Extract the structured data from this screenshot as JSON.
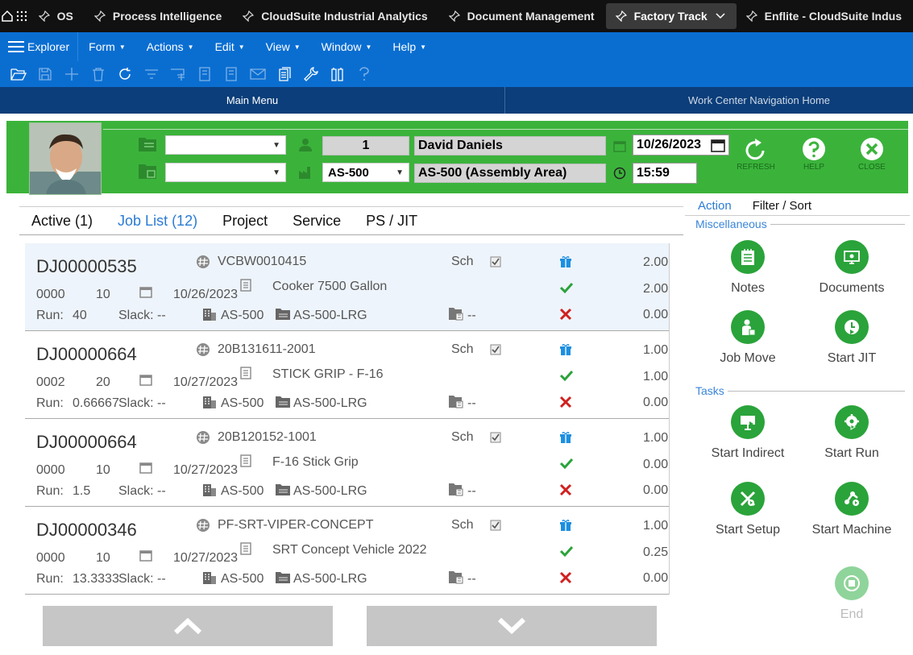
{
  "appbar": {
    "tabs": [
      {
        "label": "OS"
      },
      {
        "label": "Process Intelligence"
      },
      {
        "label": "CloudSuite Industrial Analytics"
      },
      {
        "label": "Document Management"
      },
      {
        "label": "Factory Track",
        "active": true
      },
      {
        "label": "Enflite - CloudSuite Indus"
      }
    ]
  },
  "menubar": {
    "explorer": "Explorer",
    "items": [
      "Form",
      "Actions",
      "Edit",
      "View",
      "Window",
      "Help"
    ]
  },
  "nav": {
    "main_menu": "Main Menu",
    "work_center": "Work Center Navigation Home"
  },
  "header": {
    "select1": "",
    "select2": "",
    "employee_id": "1",
    "employee_name": "David Daniels",
    "work_center": "AS-500",
    "work_center_desc": "AS-500 (Assembly Area)",
    "date": "10/26/2023",
    "time": "15:59",
    "refresh": "REFRESH",
    "help": "HELP",
    "close": "CLOSE"
  },
  "tabs": [
    "Active (1)",
    "Job List (12)",
    "Project",
    "Service",
    "PS / JIT"
  ],
  "jobs": [
    {
      "job": "DJ00000535",
      "item": "VCBW0010415",
      "sch": "Sch",
      "suffix": "0000",
      "oper": "10",
      "date": "10/26/2023",
      "desc": "Cooker 7500 Gallon",
      "run_label": "Run:",
      "run": "40",
      "slack": "Slack: --",
      "wc": "AS-500",
      "loc": "AS-500-LRG",
      "ship": "--",
      "q1": "2.00",
      "q2": "2.00",
      "q3": "0.00"
    },
    {
      "job": "DJ00000664",
      "item": "20B131611-2001",
      "sch": "Sch",
      "suffix": "0002",
      "oper": "20",
      "date": "10/27/2023",
      "desc": "STICK GRIP - F-16",
      "run_label": "Run:",
      "run": "0.66667",
      "slack": "Slack: --",
      "wc": "AS-500",
      "loc": "AS-500-LRG",
      "ship": "--",
      "q1": "1.00",
      "q2": "1.00",
      "q3": "0.00"
    },
    {
      "job": "DJ00000664",
      "item": "20B120152-1001",
      "sch": "Sch",
      "suffix": "0000",
      "oper": "10",
      "date": "10/27/2023",
      "desc": "F-16 Stick Grip",
      "run_label": "Run:",
      "run": "1.5",
      "slack": "Slack: --",
      "wc": "AS-500",
      "loc": "AS-500-LRG",
      "ship": "--",
      "q1": "1.00",
      "q2": "0.00",
      "q3": "0.00"
    },
    {
      "job": "DJ00000346",
      "item": "PF-SRT-VIPER-CONCEPT",
      "sch": "Sch",
      "suffix": "0000",
      "oper": "10",
      "date": "10/27/2023",
      "desc": "SRT Concept Vehicle 2022",
      "run_label": "Run:",
      "run": "13.3333",
      "slack": "Slack: --",
      "wc": "AS-500",
      "loc": "AS-500-LRG",
      "ship": "--",
      "q1": "1.00",
      "q2": "0.25",
      "q3": "0.00"
    }
  ],
  "rightpane": {
    "tab_action": "Action",
    "tab_filter": "Filter / Sort",
    "misc": "Miscellaneous",
    "tasks": "Tasks",
    "notes": "Notes",
    "documents": "Documents",
    "job_move": "Job Move",
    "start_jit": "Start JIT",
    "start_indirect": "Start Indirect",
    "start_run": "Start Run",
    "start_setup": "Start Setup",
    "start_machine": "Start Machine",
    "end": "End"
  },
  "colors": {
    "accent_blue": "#0a6ed1",
    "header_green": "#3bb33b",
    "ok_green": "#2aa33a",
    "cancel_red": "#d0201f",
    "link_blue": "#2a7bd4"
  }
}
